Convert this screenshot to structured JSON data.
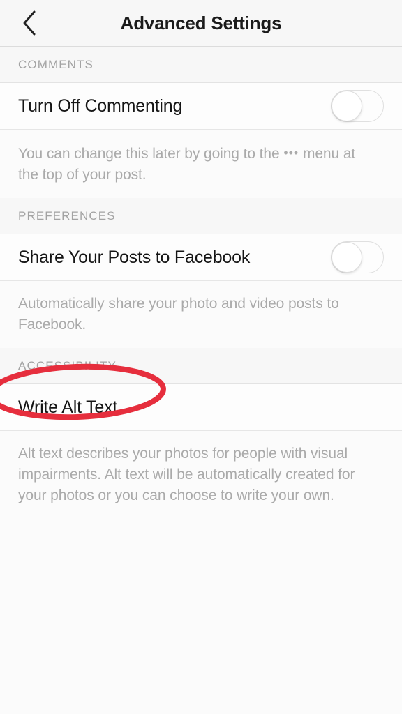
{
  "navbar": {
    "title": "Advanced Settings",
    "back_icon": "chevron-left-icon"
  },
  "sections": [
    {
      "header": "COMMENTS",
      "row_label": "Turn Off Commenting",
      "control": "toggle",
      "toggle_state": "off",
      "helper_part1": "You can change this later by going to the ",
      "helper_dots": "•••",
      "helper_part2": " menu at the top of your post."
    },
    {
      "header": "PREFERENCES",
      "row_label": "Share Your Posts to Facebook",
      "control": "toggle",
      "toggle_state": "off",
      "helper": "Automatically share your photo and video posts to Facebook."
    },
    {
      "header": "ACCESSIBILITY",
      "row_label": "Write Alt Text",
      "control": "none",
      "helper": "Alt text describes your photos for people with visual impairments. Alt text will be automatically created for your photos or you can choose to write your own."
    }
  ],
  "annotation": {
    "shape": "ellipse",
    "color": "#e62e3d",
    "target": "Write Alt Text"
  },
  "colors": {
    "background": "#fbfbfb",
    "navbar": "#f7f7f7",
    "row_background": "#fdfdfd",
    "primary_text": "#151515",
    "secondary_text": "#aaaaaa",
    "section_text": "#a3a3a3",
    "divider": "#e6e6e6",
    "annotation_red": "#e62e3d"
  }
}
